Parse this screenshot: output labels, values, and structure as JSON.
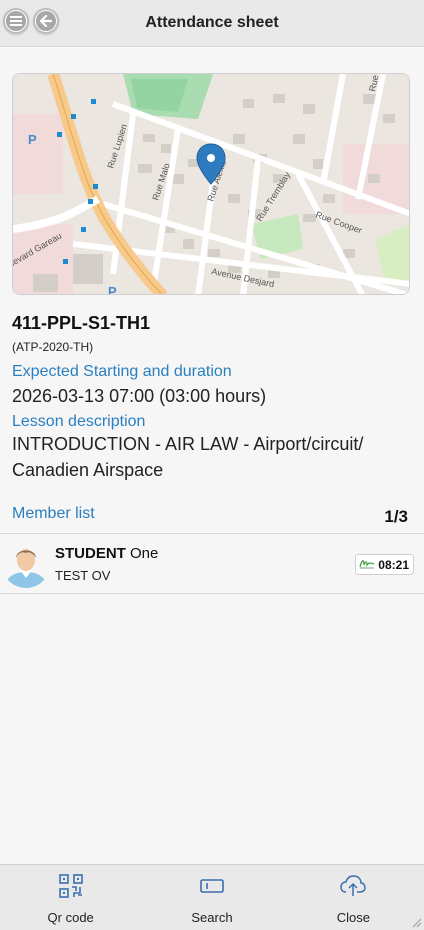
{
  "header": {
    "title": "Attendance sheet"
  },
  "map": {
    "streets": [
      "Rue Lupien",
      "Rue Malo",
      "Rue Alexis",
      "Rue Tremblay",
      "Rue Cooper",
      "levard Gareau",
      "Avenue Desjard",
      "Rue"
    ]
  },
  "lesson": {
    "title": "411-PPL-S1-TH1",
    "code": "(ATP-2020-TH)",
    "start_label": "Expected Starting and duration",
    "start_value": "2026-03-13 07:00 (03:00 hours)",
    "desc_label": "Lesson description",
    "desc_value": "INTRODUCTION - AIR LAW - Airport/circuit/ Canadien Airspace"
  },
  "members": {
    "label": "Member list",
    "count": "1/3",
    "items": [
      {
        "last_name": "STUDENT",
        "first_name": "One",
        "sub": "TEST OV",
        "time": "08:21"
      }
    ]
  },
  "footer": {
    "qr_label": "Qr code",
    "search_label": "Search",
    "close_label": "Close"
  },
  "colors": {
    "accent": "#2a7fc0",
    "marker": "#2f7bbf"
  }
}
